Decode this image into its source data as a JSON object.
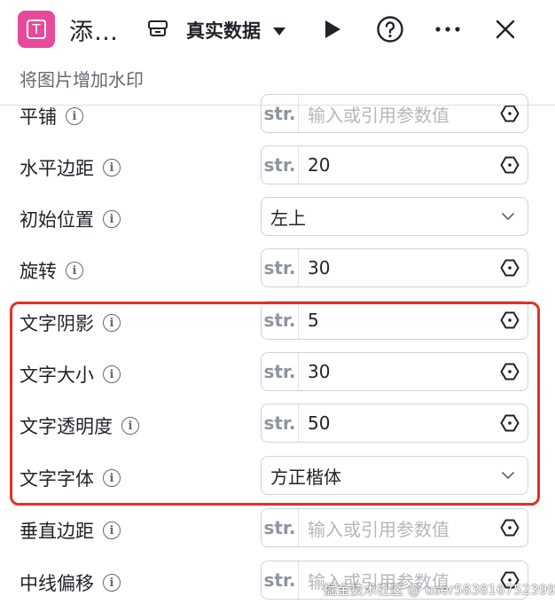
{
  "header": {
    "app_icon_letter": "T",
    "title": "添…",
    "data_source": "真实数据",
    "subtitle": "将图片增加水印"
  },
  "rows": [
    {
      "label": "平铺",
      "kind": "input",
      "type": "str.",
      "value": "",
      "placeholder": "输入或引用参数值"
    },
    {
      "label": "水平边距",
      "kind": "input",
      "type": "str.",
      "value": "20",
      "placeholder": ""
    },
    {
      "label": "初始位置",
      "kind": "select",
      "value": "左上"
    },
    {
      "label": "旋转",
      "kind": "input",
      "type": "str.",
      "value": "30",
      "placeholder": ""
    },
    {
      "label": "文字阴影",
      "kind": "input",
      "type": "str.",
      "value": "5",
      "placeholder": ""
    },
    {
      "label": "文字大小",
      "kind": "input",
      "type": "str.",
      "value": "30",
      "placeholder": ""
    },
    {
      "label": "文字透明度",
      "kind": "input",
      "type": "str.",
      "value": "50",
      "placeholder": ""
    },
    {
      "label": "文字字体",
      "kind": "select",
      "value": "方正楷体"
    },
    {
      "label": "垂直边距",
      "kind": "input",
      "type": "str.",
      "value": "",
      "placeholder": "输入或引用参数值"
    },
    {
      "label": "中线偏移",
      "kind": "input",
      "type": "str.",
      "value": "",
      "placeholder": "输入或引用参数值"
    }
  ],
  "info_glyph": "i",
  "watermark": "掘金技术社区 @ user5838167523996",
  "colors": {
    "accent": "#e84a9b",
    "highlight": "#e52f25",
    "muted": "#646a73"
  }
}
